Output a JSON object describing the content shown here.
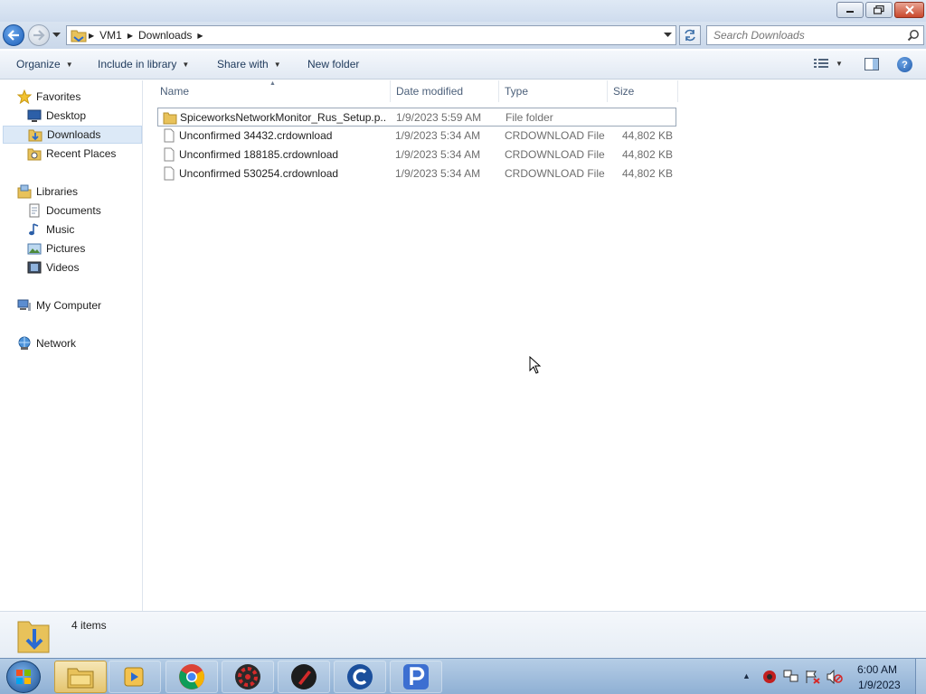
{
  "window": {
    "caption_buttons": [
      "minimize-icon",
      "maximize-icon",
      "close-icon"
    ]
  },
  "address": {
    "crumbs": [
      "VM1",
      "Downloads"
    ],
    "search_placeholder": "Search Downloads"
  },
  "commandbar": {
    "organize": "Organize",
    "include": "Include in library",
    "share": "Share with",
    "newfolder": "New folder"
  },
  "nav": {
    "favorites": "Favorites",
    "desktop": "Desktop",
    "downloads": "Downloads",
    "recent": "Recent Places",
    "libraries": "Libraries",
    "documents": "Documents",
    "music": "Music",
    "pictures": "Pictures",
    "videos": "Videos",
    "computer": "My Computer",
    "network": "Network",
    "selected": "Downloads"
  },
  "columns": {
    "name": "Name",
    "date": "Date modified",
    "type": "Type",
    "size": "Size"
  },
  "files": [
    {
      "name": "SpiceworksNetworkMonitor_Rus_Setup.p...",
      "date": "1/9/2023 5:59 AM",
      "type": "File folder",
      "size": "",
      "icon": "folder-icon"
    },
    {
      "name": "Unconfirmed 34432.crdownload",
      "date": "1/9/2023 5:34 AM",
      "type": "CRDOWNLOAD File",
      "size": "44,802 KB",
      "icon": "file-icon"
    },
    {
      "name": "Unconfirmed 188185.crdownload",
      "date": "1/9/2023 5:34 AM",
      "type": "CRDOWNLOAD File",
      "size": "44,802 KB",
      "icon": "file-icon"
    },
    {
      "name": "Unconfirmed 530254.crdownload",
      "date": "1/9/2023 5:34 AM",
      "type": "CRDOWNLOAD File",
      "size": "44,802 KB",
      "icon": "file-icon"
    }
  ],
  "details": {
    "count": "4 items"
  },
  "taskbar": {
    "apps": [
      "explorer-icon",
      "media-player-icon",
      "chrome-icon",
      "red-gear-app-icon",
      "red-pen-app-icon",
      "ccleaner-icon",
      "p-app-icon"
    ],
    "tray_icons": [
      "security-icon",
      "network-icon",
      "flag-icon",
      "volume-muted-icon"
    ],
    "time": "6:00 AM",
    "date": "1/9/2023"
  },
  "colors": {
    "accent": "#1d5fb8",
    "selection": "#dce9f7",
    "taskbar": "#9fbcdc"
  }
}
